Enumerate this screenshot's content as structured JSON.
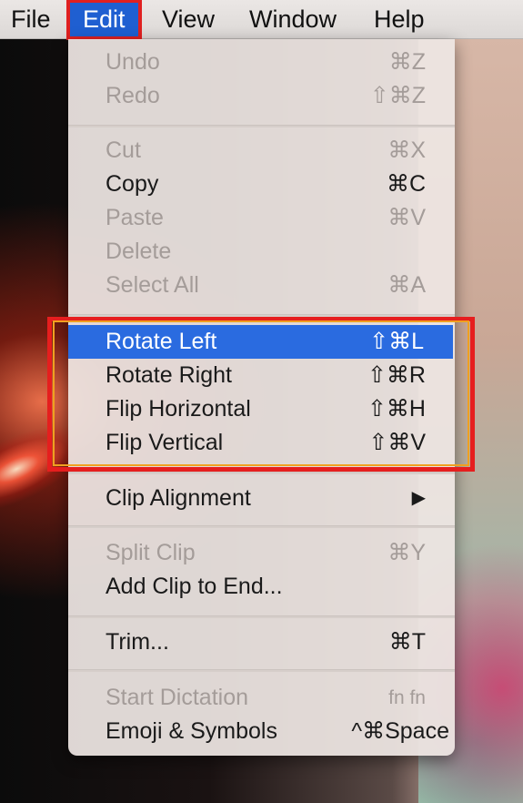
{
  "menubar": {
    "items": [
      "File",
      "Edit",
      "View",
      "Window",
      "Help"
    ],
    "active": "Edit"
  },
  "menu": {
    "items": [
      {
        "label": "Undo",
        "shortcut": "⌘Z",
        "disabled": true
      },
      {
        "label": "Redo",
        "shortcut": "⇧⌘Z",
        "disabled": true
      },
      {
        "label": "Cut",
        "shortcut": "⌘X",
        "disabled": true
      },
      {
        "label": "Copy",
        "shortcut": "⌘C",
        "disabled": false
      },
      {
        "label": "Paste",
        "shortcut": "⌘V",
        "disabled": true
      },
      {
        "label": "Delete",
        "shortcut": "",
        "disabled": true
      },
      {
        "label": "Select All",
        "shortcut": "⌘A",
        "disabled": true
      },
      {
        "label": "Rotate Left",
        "shortcut": "⇧⌘L",
        "disabled": false,
        "highlighted": true
      },
      {
        "label": "Rotate Right",
        "shortcut": "⇧⌘R",
        "disabled": false
      },
      {
        "label": "Flip Horizontal",
        "shortcut": "⇧⌘H",
        "disabled": false
      },
      {
        "label": "Flip Vertical",
        "shortcut": "⇧⌘V",
        "disabled": false
      },
      {
        "label": "Clip Alignment",
        "shortcut": "▶",
        "disabled": false,
        "submenu": true
      },
      {
        "label": "Split Clip",
        "shortcut": "⌘Y",
        "disabled": true
      },
      {
        "label": "Add Clip to End...",
        "shortcut": "",
        "disabled": false
      },
      {
        "label": "Trim...",
        "shortcut": "⌘T",
        "disabled": false
      },
      {
        "label": "Start Dictation",
        "shortcut": "fn fn",
        "disabled": true
      },
      {
        "label": "Emoji & Symbols",
        "shortcut": "^⌘Space",
        "disabled": false
      }
    ]
  },
  "colors": {
    "highlight": "#2a6be0",
    "annotation_red": "#e61e1e",
    "annotation_orange": "#f0a020"
  }
}
